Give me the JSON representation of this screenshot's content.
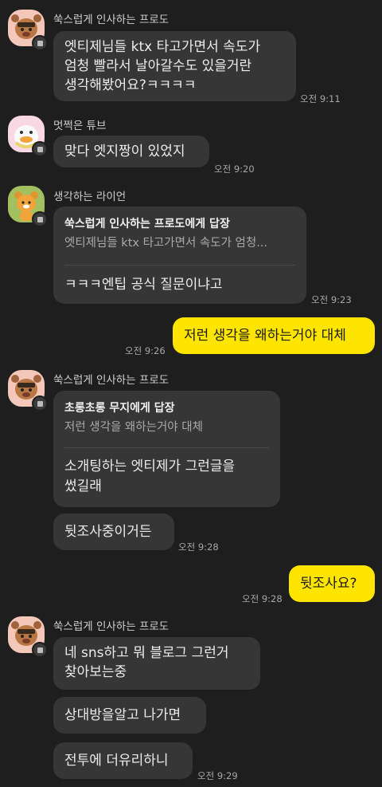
{
  "messages": {
    "m1": {
      "sender": "쑥스럽게 인사하는 프로도",
      "text": "엣티제님들 ktx 타고가면서 속도가\n엄청 빨라서 날아갈수도 있을거란\n생각해봤어요?ㅋㅋㅋㅋ",
      "time": "오전 9:11"
    },
    "m2": {
      "sender": "멋쩍은 튜브",
      "text": "맞다 엣지짱이 있었지",
      "time": "오전 9:20"
    },
    "m3": {
      "sender": "생각하는 라이언",
      "reply_title": "쑥스럽게 인사하는 프로도에게 답장",
      "reply_quote": "엣티제님들 ktx 타고가면서 속도가 엄청...",
      "text": "ㅋㅋㅋ엔팁 공식 질문이냐고",
      "time": "오전 9:23"
    },
    "m4": {
      "text": "저런 생각을 왜하는거야 대체",
      "time": "오전 9:26"
    },
    "m5": {
      "sender": "쑥스럽게 인사하는 프로도",
      "reply_title": "초롱초롱 무지에게 답장",
      "reply_quote": "저런 생각을 왜하는거야 대체",
      "text": "소개팅하는 엣티제가 그런글을\n썼길래",
      "text2": "뒷조사중이거든",
      "time": "오전 9:28"
    },
    "m6": {
      "text": "뒷조사요?",
      "time": "오전 9:28"
    },
    "m7": {
      "sender": "쑥스럽게 인사하는 프로도",
      "text": "네 sns하고 뭐 블로그 그런거\n찾아보는중",
      "text2": "상대방을알고 나가면",
      "text3": "전투에 더유리하니",
      "time": "오전 9:29"
    }
  },
  "icons": {
    "avatar1": "frodo-avatar",
    "avatar2": "tube-avatar",
    "avatar3": "ryan-avatar"
  },
  "colors": {
    "background": "#1e1e1e",
    "bubble_other": "#363636",
    "bubble_me": "#fee500"
  }
}
